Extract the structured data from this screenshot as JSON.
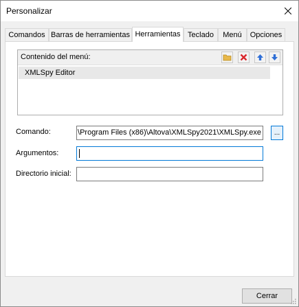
{
  "window": {
    "title": "Personalizar"
  },
  "tabs": [
    {
      "label": "Comandos"
    },
    {
      "label": "Barras de herramientas"
    },
    {
      "label": "Herramientas",
      "active": true
    },
    {
      "label": "Teclado"
    },
    {
      "label": "Menú"
    },
    {
      "label": "Opciones"
    }
  ],
  "menu_contents": {
    "label": "Contenido del menú:",
    "toolbar": [
      {
        "icon": "folder-icon",
        "color": "#e8b84a"
      },
      {
        "icon": "delete-icon",
        "color": "#d9262b"
      },
      {
        "icon": "move-up-icon",
        "color": "#2f6fd6"
      },
      {
        "icon": "move-down-icon",
        "color": "#2f6fd6"
      }
    ],
    "items": [
      "XMLSpy Editor"
    ]
  },
  "fields": {
    "command": {
      "label": "Comando:",
      "value": ":\\Program Files (x86)\\Altova\\XMLSpy2021\\XMLSpy.exe"
    },
    "arguments": {
      "label": "Argumentos:",
      "value": ""
    },
    "initial_dir": {
      "label": "Directorio inicial:",
      "value": ""
    }
  },
  "browse_button": {
    "label": "..."
  },
  "footer": {
    "close_label": "Cerrar"
  },
  "colors": {
    "focus": "#0078d7",
    "selection": "#e8e8e8"
  }
}
